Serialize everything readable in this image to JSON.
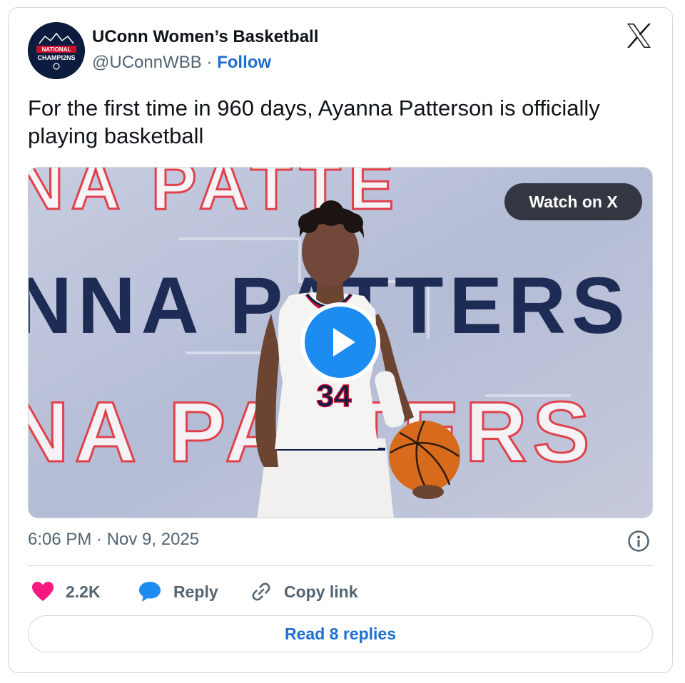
{
  "author": {
    "name": "UConn Women’s Basketball",
    "handle": "@UConnWBB",
    "separator": " · ",
    "follow_label": "Follow",
    "avatar_text_line1": "NATIONAL",
    "avatar_text_line2": "CHAMPI2NS"
  },
  "tweet": {
    "text": "For the first time in 960 days, Ayanna Patterson is officially playing basketball",
    "timestamp": "6:06 PM · Nov 9, 2025"
  },
  "media": {
    "watch_label": "Watch on X",
    "jersey_number": "34",
    "backdrop_text_top": "NA PATTE",
    "backdrop_text_mid": "NNA PATTERS",
    "backdrop_text_bot": "NA PATTERS"
  },
  "actions": {
    "like_count": "2.2K",
    "reply_label": "Reply",
    "copy_link_label": "Copy link",
    "read_replies_label": "Read 8 replies"
  },
  "colors": {
    "accent": "#1d6fd1",
    "like": "#f91880",
    "play": "#1d8cf0"
  },
  "icons": [
    "x-logo-icon",
    "play-icon",
    "info-icon",
    "heart-icon",
    "reply-bubble-icon",
    "link-icon"
  ]
}
